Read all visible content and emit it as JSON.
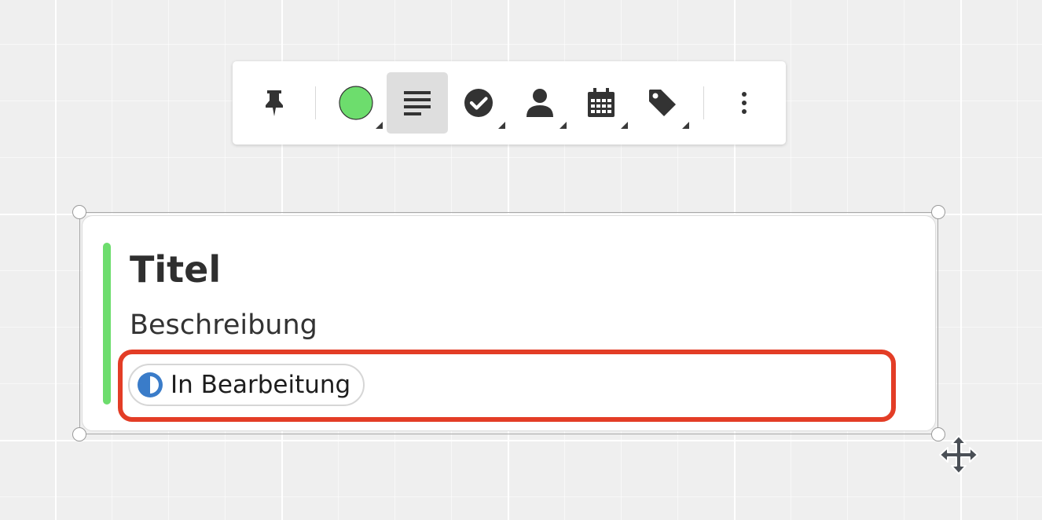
{
  "toolbar": {
    "buttons": [
      {
        "name": "pin",
        "icon": "pin-icon"
      },
      {
        "name": "color",
        "icon": "color-circle-icon",
        "color": "#6ddd6d",
        "has_menu": true
      },
      {
        "name": "description",
        "icon": "text-align-icon",
        "active": true
      },
      {
        "name": "status",
        "icon": "check-circle-icon",
        "has_menu": true
      },
      {
        "name": "assignee",
        "icon": "person-icon",
        "has_menu": true
      },
      {
        "name": "due-date",
        "icon": "calendar-icon",
        "has_menu": true
      },
      {
        "name": "tags",
        "icon": "tag-icon",
        "has_menu": true
      },
      {
        "name": "more",
        "icon": "more-vertical-icon"
      }
    ]
  },
  "card": {
    "title": "Titel",
    "description": "Beschreibung",
    "accent_color": "#6ddd6d",
    "status": {
      "label": "In Bearbeitung",
      "icon": "half-circle-icon",
      "icon_color": "#3a7cc9"
    }
  },
  "highlight_color": "#e33d26",
  "cursor": "move-cursor-icon"
}
